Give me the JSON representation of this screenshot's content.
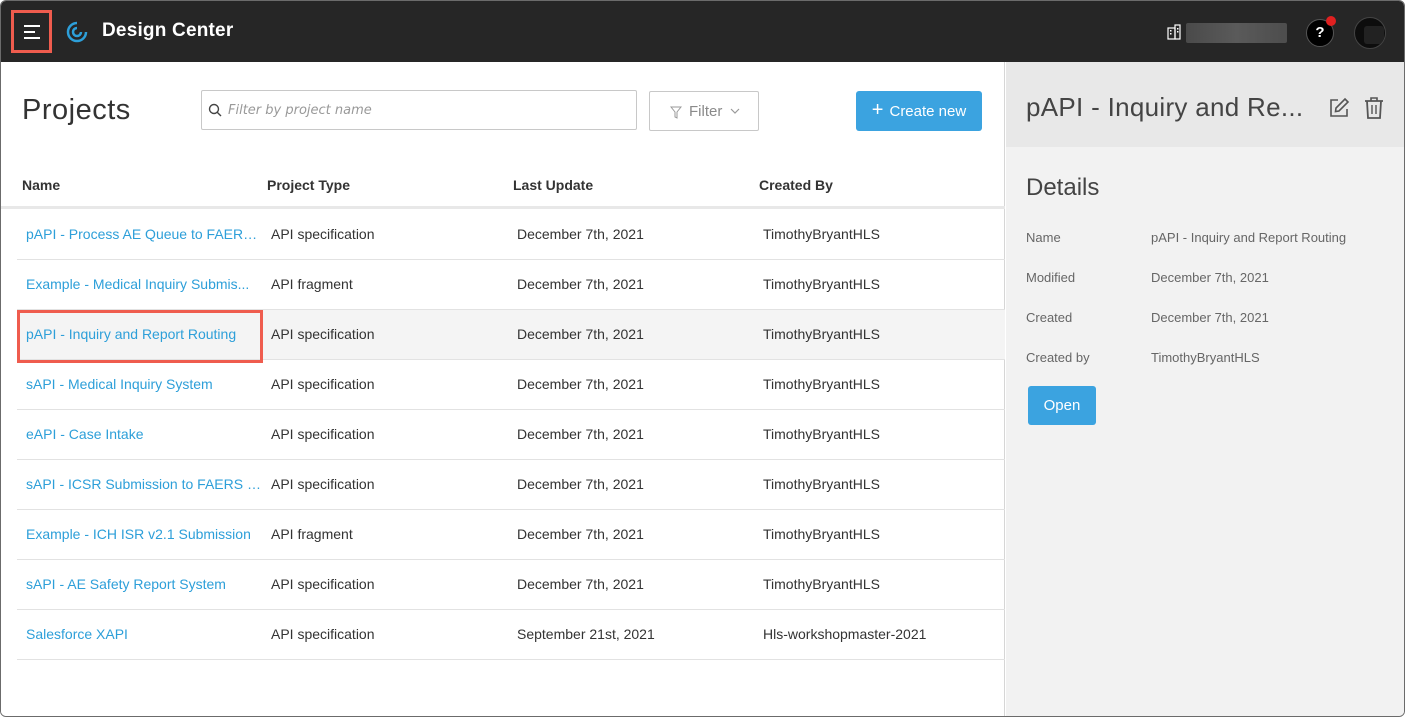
{
  "app": {
    "title": "Design Center"
  },
  "topbar": {
    "menu_icon": "hamburger-menu-icon",
    "logo_icon": "design-center-logo-icon",
    "org_icon": "building-icon",
    "help_label": "?",
    "notification_color": "#e02020"
  },
  "projects": {
    "title": "Projects",
    "search": {
      "placeholder": "Filter by project name",
      "value": ""
    },
    "filter_label": "Filter",
    "create_label": "Create new",
    "columns": [
      "Name",
      "Project Type",
      "Last Update",
      "Created By"
    ],
    "rows": [
      {
        "name": "pAPI - Process AE Queue to FAERS ...",
        "type": "API specification",
        "updated": "December 7th, 2021",
        "created_by": "TimothyBryantHLS"
      },
      {
        "name": "Example - Medical Inquiry Submis...",
        "type": "API fragment",
        "updated": "December 7th, 2021",
        "created_by": "TimothyBryantHLS"
      },
      {
        "name": "pAPI - Inquiry and Report Routing",
        "type": "API specification",
        "updated": "December 7th, 2021",
        "created_by": "TimothyBryantHLS"
      },
      {
        "name": "sAPI - Medical Inquiry System",
        "type": "API specification",
        "updated": "December 7th, 2021",
        "created_by": "TimothyBryantHLS"
      },
      {
        "name": "eAPI - Case Intake",
        "type": "API specification",
        "updated": "December 7th, 2021",
        "created_by": "TimothyBryantHLS"
      },
      {
        "name": "sAPI - ICSR Submission to FAERS S...",
        "type": "API specification",
        "updated": "December 7th, 2021",
        "created_by": "TimothyBryantHLS"
      },
      {
        "name": "Example - ICH ISR v2.1 Submission",
        "type": "API fragment",
        "updated": "December 7th, 2021",
        "created_by": "TimothyBryantHLS"
      },
      {
        "name": "sAPI - AE Safety Report System",
        "type": "API specification",
        "updated": "December 7th, 2021",
        "created_by": "TimothyBryantHLS"
      },
      {
        "name": "Salesforce XAPI",
        "type": "API specification",
        "updated": "September 21st, 2021",
        "created_by": "Hls-workshopmaster-2021"
      }
    ]
  },
  "details_panel": {
    "header_title": "pAPI - Inquiry and Re...",
    "edit_icon": "edit-icon",
    "delete_icon": "trash-icon",
    "section_title": "Details",
    "fields": [
      {
        "label": "Name",
        "value": "pAPI - Inquiry and Report Routing"
      },
      {
        "label": "Modified",
        "value": "December 7th, 2021"
      },
      {
        "label": "Created",
        "value": "December 7th, 2021"
      },
      {
        "label": "Created by",
        "value": "TimothyBryantHLS"
      }
    ],
    "open_label": "Open"
  },
  "colors": {
    "topbar_bg": "#262626",
    "accent_blue": "#3ba3e0",
    "link_blue": "#2d9fd9",
    "highlight_red": "#ef5c4e"
  }
}
